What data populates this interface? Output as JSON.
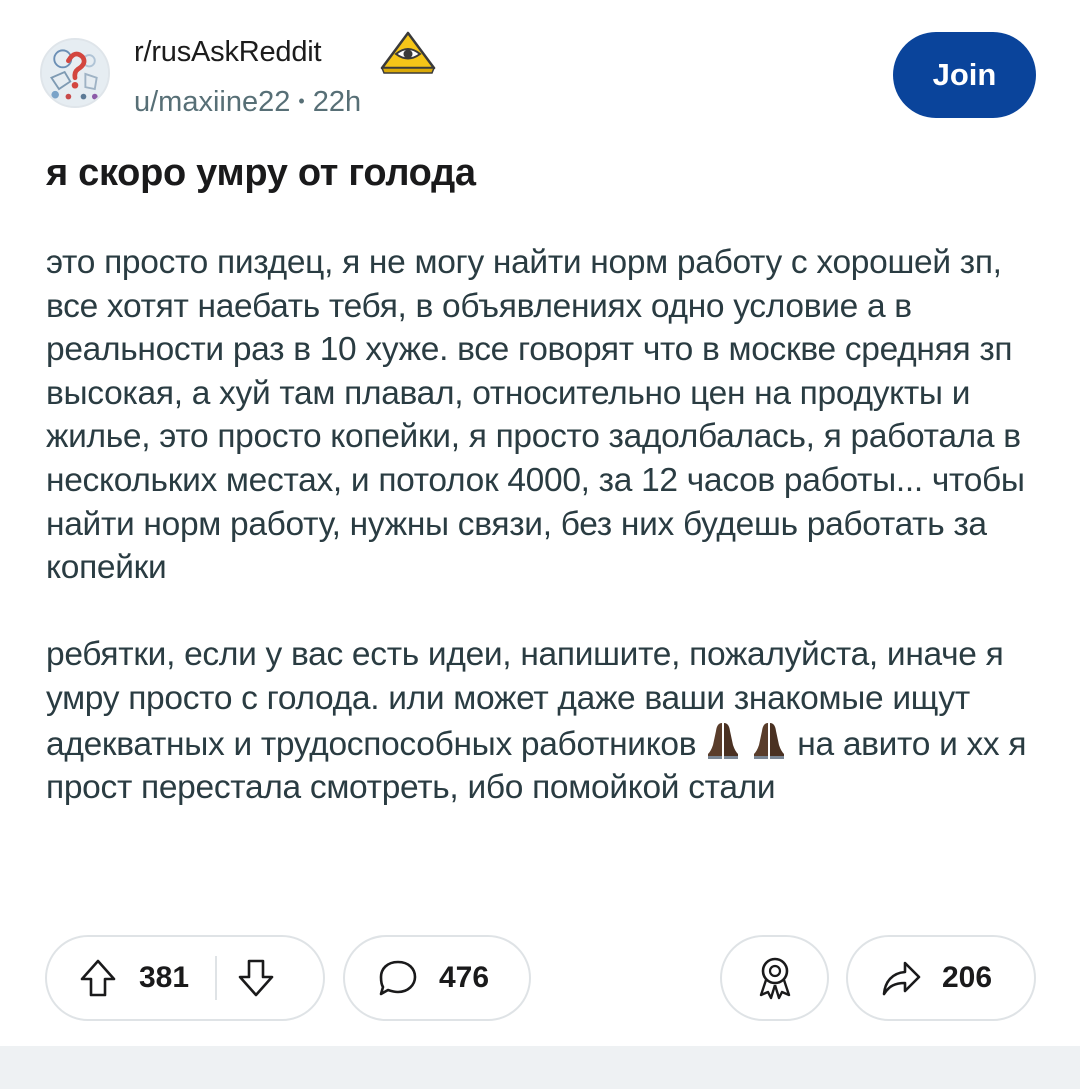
{
  "header": {
    "subreddit": "r/rusAskReddit",
    "username": "u/maxiine22",
    "separator": "•",
    "time": "22h",
    "join_label": "Join",
    "avatar_icon": "subreddit-avatar-icon",
    "badge_icon": "pyramid-eye-icon"
  },
  "post": {
    "title": "я скоро умру от голода",
    "paragraph1": "это просто пиздец, я не могу найти норм работу с хорошей зп, все хотят наебать тебя, в объявлениях одно условие а в реальности раз в 10 хуже. все говорят что в москве средняя зп высокая, а хуй там плавал, относительно цен на продукты и жилье, это просто копейки, я просто задолбалась, я работала в нескольких местах, и потолок 4000, за 12 часов работы... чтобы найти норм работу, нужны связи, без них будешь работать за копейки",
    "paragraph2_before": "ребятки, если у вас есть идеи, напишите, пожалуйста, иначе я умру просто с голода. или может даже ваши знакомые ищут адекватных и трудоспособных работников",
    "paragraph2_after": "на авито и хх я прост перестала смотреть, ибо помойкой стали",
    "emoji": "folded-hands-emoji"
  },
  "actions": {
    "upvotes": "381",
    "comments": "476",
    "shares": "206"
  },
  "colors": {
    "join_button": "#0a449b",
    "meta_text": "#576f76",
    "body_text": "#2a3c42",
    "pill_border": "#dfe3e6",
    "badge_yellow": "#f5c518"
  }
}
